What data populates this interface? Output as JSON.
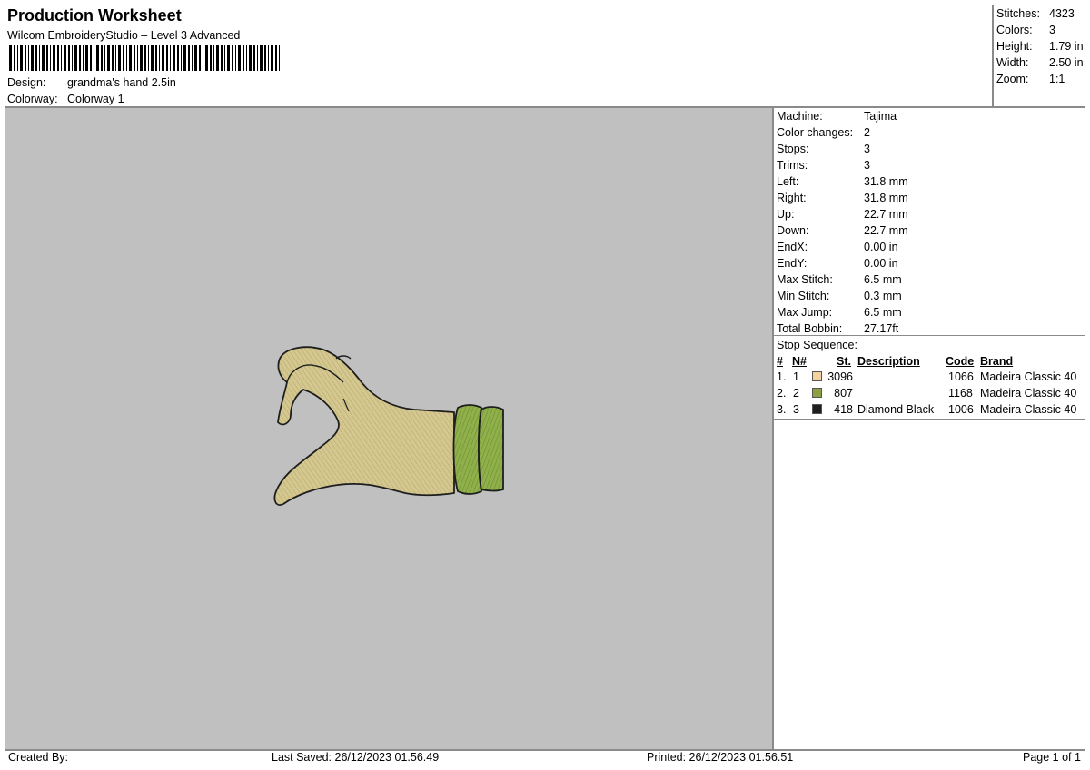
{
  "header": {
    "title": "Production Worksheet",
    "subtitle": "Wilcom EmbroideryStudio – Level 3 Advanced",
    "design_label": "Design:",
    "design_value": "grandma's hand 2.5in",
    "colorway_label": "Colorway:",
    "colorway_value": "Colorway 1"
  },
  "summary": [
    {
      "label": "Stitches:",
      "value": "4323"
    },
    {
      "label": "Colors:",
      "value": "3"
    },
    {
      "label": "Height:",
      "value": "1.79 in"
    },
    {
      "label": "Width:",
      "value": "2.50 in"
    },
    {
      "label": "Zoom:",
      "value": "1:1"
    }
  ],
  "machine_info": [
    {
      "label": "Machine:",
      "value": "Tajima"
    },
    {
      "label": "Color changes:",
      "value": "2"
    },
    {
      "label": "Stops:",
      "value": "3"
    },
    {
      "label": "Trims:",
      "value": "3"
    },
    {
      "label": "Left:",
      "value": "31.8 mm"
    },
    {
      "label": "Right:",
      "value": "31.8 mm"
    },
    {
      "label": "Up:",
      "value": "22.7 mm"
    },
    {
      "label": "Down:",
      "value": "22.7 mm"
    },
    {
      "label": "EndX:",
      "value": "0.00 in"
    },
    {
      "label": "EndY:",
      "value": "0.00 in"
    },
    {
      "label": "Max Stitch:",
      "value": "6.5 mm"
    },
    {
      "label": "Min Stitch:",
      "value": "0.3 mm"
    },
    {
      "label": "Max Jump:",
      "value": "6.5 mm"
    },
    {
      "label": "Total Bobbin:",
      "value": "27.17ft"
    }
  ],
  "stop_sequence": {
    "title": "Stop Sequence:",
    "columns": {
      "num": "#",
      "n": "N#",
      "st": "St.",
      "description": "Description",
      "code": "Code",
      "brand": "Brand"
    },
    "rows": [
      {
        "num": "1.",
        "n": "1",
        "color": "#f5d3a0",
        "st": "3096",
        "description": "",
        "code": "1066",
        "brand": "Madeira Classic 40"
      },
      {
        "num": "2.",
        "n": "2",
        "color": "#8aa043",
        "st": "807",
        "description": "",
        "code": "1168",
        "brand": "Madeira Classic 40"
      },
      {
        "num": "3.",
        "n": "3",
        "color": "#1e1e1e",
        "st": "418",
        "description": "Diamond Black",
        "code": "1006",
        "brand": "Madeira Classic 40"
      }
    ]
  },
  "footer": {
    "created_by": "Created By:",
    "last_saved": "Last Saved: 26/12/2023 01.56.49",
    "printed": "Printed: 26/12/2023 01.56.51",
    "page": "Page 1 of 1"
  },
  "colors": {
    "preview_background": "#c0c0c0",
    "hand_fill": "#d4c890",
    "cuff_fill": "#8fb04a",
    "outline": "#1e1e1e"
  }
}
